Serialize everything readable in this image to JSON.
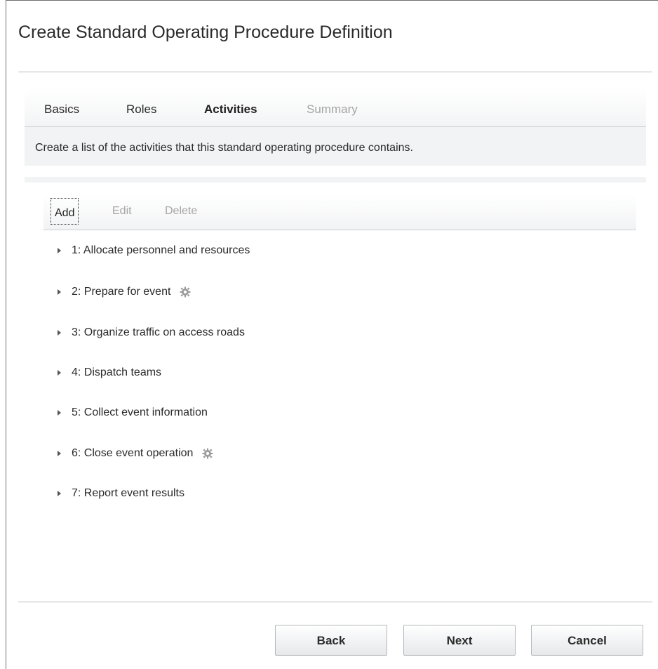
{
  "dialog": {
    "title": "Create Standard Operating Procedure Definition"
  },
  "tabs": [
    {
      "label": "Basics",
      "state": "normal"
    },
    {
      "label": "Roles",
      "state": "normal"
    },
    {
      "label": "Activities",
      "state": "active"
    },
    {
      "label": "Summary",
      "state": "disabled"
    }
  ],
  "step_description": "Create a list of the activities that this standard operating procedure contains.",
  "toolbar": {
    "add_label": "Add",
    "edit_label": "Edit",
    "delete_label": "Delete"
  },
  "activities": [
    {
      "label": "1: Allocate personnel and resources",
      "automated": false,
      "icon": "expand-arrow-icon"
    },
    {
      "label": "2: Prepare for event",
      "automated": true,
      "icon": "gear-icon"
    },
    {
      "label": "3: Organize traffic on access roads",
      "automated": false,
      "icon": "expand-arrow-icon"
    },
    {
      "label": "4: Dispatch teams",
      "automated": false,
      "icon": "expand-arrow-icon"
    },
    {
      "label": "5: Collect event information",
      "automated": false,
      "icon": "expand-arrow-icon"
    },
    {
      "label": "6: Close event operation",
      "automated": true,
      "icon": "gear-icon"
    },
    {
      "label": "7: Report event results",
      "automated": false,
      "icon": "expand-arrow-icon"
    }
  ],
  "footer": {
    "back_label": "Back",
    "next_label": "Next",
    "cancel_label": "Cancel"
  },
  "colors": {
    "disabled_text": "#a5a5a5",
    "panel_background": "#f1f3f4",
    "rule": "#bdbdbd"
  }
}
